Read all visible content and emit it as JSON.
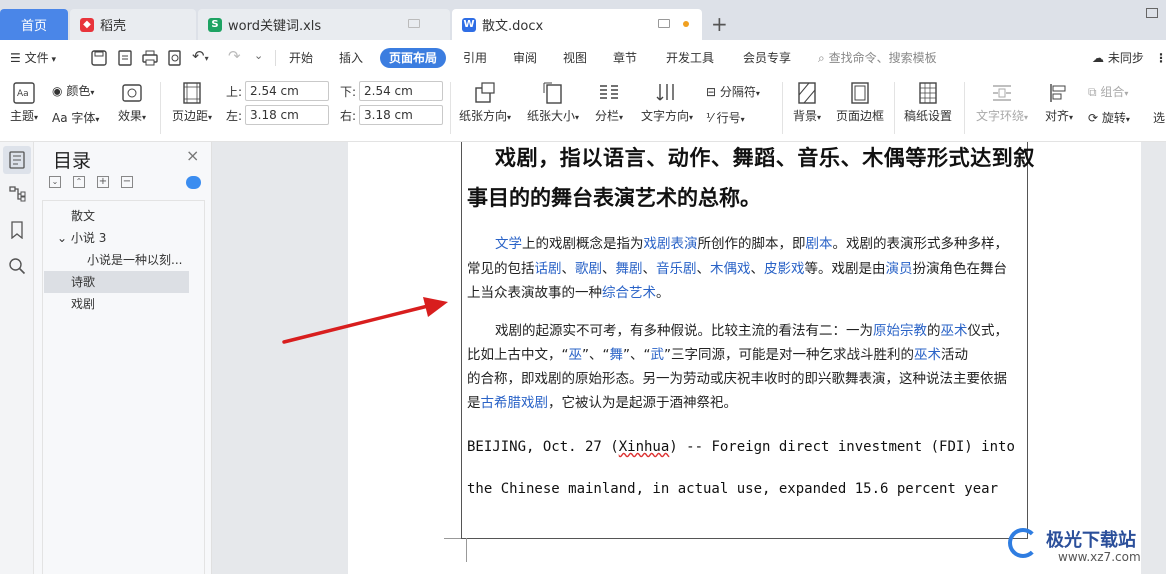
{
  "tabs": [
    {
      "label": "首页"
    },
    {
      "label": "稻壳"
    },
    {
      "label": "word关键词.xls"
    },
    {
      "label": "散文.docx"
    }
  ],
  "menu": {
    "file": "文件",
    "items": [
      "开始",
      "插入",
      "页面布局",
      "引用",
      "审阅",
      "视图",
      "章节",
      "开发工具",
      "会员专享"
    ],
    "active": "页面布局",
    "search": "查找命令、搜索模板",
    "sync": "未同步"
  },
  "ribbon": {
    "theme": "主题",
    "color": "颜色",
    "font": "Aa 字体",
    "effect": "效果",
    "margins": "页边距",
    "margin_top_label": "上:",
    "margin_top": "2.54 cm",
    "margin_bottom_label": "下:",
    "margin_bottom": "2.54 cm",
    "margin_left_label": "左:",
    "margin_left": "3.18 cm",
    "margin_right_label": "右:",
    "margin_right": "3.18 cm",
    "orientation": "纸张方向",
    "size": "纸张大小",
    "columns": "分栏",
    "text_direction": "文字方向",
    "breaks": "分隔符",
    "line_numbers": "行号",
    "background": "背景",
    "page_border": "页面边框",
    "manuscript": "稿纸设置",
    "wrap": "文字环绕",
    "align": "对齐",
    "group": "组合",
    "rotate": "旋转",
    "select": "选"
  },
  "toc": {
    "title": "目录",
    "items": [
      {
        "label": "散文"
      },
      {
        "label": "小说 3"
      },
      {
        "label": "小说是一种以刻..."
      },
      {
        "label": "诗歌"
      },
      {
        "label": "戏剧"
      }
    ]
  },
  "doc": {
    "title_line1": "戏剧，指以语言、动作、舞蹈、音乐、木偶等形式达到叙",
    "title_line2": "事目的的舞台表演艺术的总称。",
    "p1": {
      "l1a": "文学",
      "l1b": "上的戏剧概念是指为",
      "l1c": "戏剧表演",
      "l1d": "所创作的脚本，即",
      "l1e": "剧本",
      "l1f": "。戏剧的表演形式多种多样，",
      "l2a": "常见的包括",
      "l2b": "话剧",
      "l2c": "、",
      "l2d": "歌剧",
      "l2e": "、",
      "l2f": "舞剧",
      "l2g": "、",
      "l2h": "音乐剧",
      "l2i": "、",
      "l2j": "木偶戏",
      "l2k": "、",
      "l2l": "皮影戏",
      "l2m": "等。戏剧是由",
      "l2n": "演员",
      "l2o": "扮演角色在舞台",
      "l3a": "上当众表演故事的一种",
      "l3b": "综合艺术",
      "l3c": "。"
    },
    "p2": {
      "l1a": "戏剧的起源实不可考，有多种假说。比较主流的看法有二：一为",
      "l1b": "原始宗教",
      "l1c": "的",
      "l1d": "巫术",
      "l1e": "仪式，",
      "l2a": "比如上古中文，“",
      "l2b": "巫",
      "l2c": "”、“",
      "l2d": "舞",
      "l2e": "”、“",
      "l2f": "武",
      "l2g": "”三字同源，可能是对一种乞求战斗胜利的",
      "l2h": "巫术",
      "l2i": "活动",
      "l3": "的合称，即戏剧的原始形态。另一为劳动或庆祝丰收时的即兴歌舞表演，这种说法主要依据",
      "l4a": "是",
      "l4b": "古希腊戏剧",
      "l4c": "，它被认为是起源于酒神祭祀。"
    },
    "en_line1a": "BEIJING, Oct. 27 (",
    "en_line1b": "Xinhua",
    "en_line1c": ") -- Foreign direct investment (FDI) into",
    "en_line2": "the Chinese mainland, in actual use, expanded 15.6 percent year"
  },
  "watermark": {
    "title": "极光下载站",
    "url": "www.xz7.com"
  },
  "colors": {
    "accent": "#3b7de0",
    "link": "#2a63c7",
    "arrow": "#d81e1e"
  }
}
